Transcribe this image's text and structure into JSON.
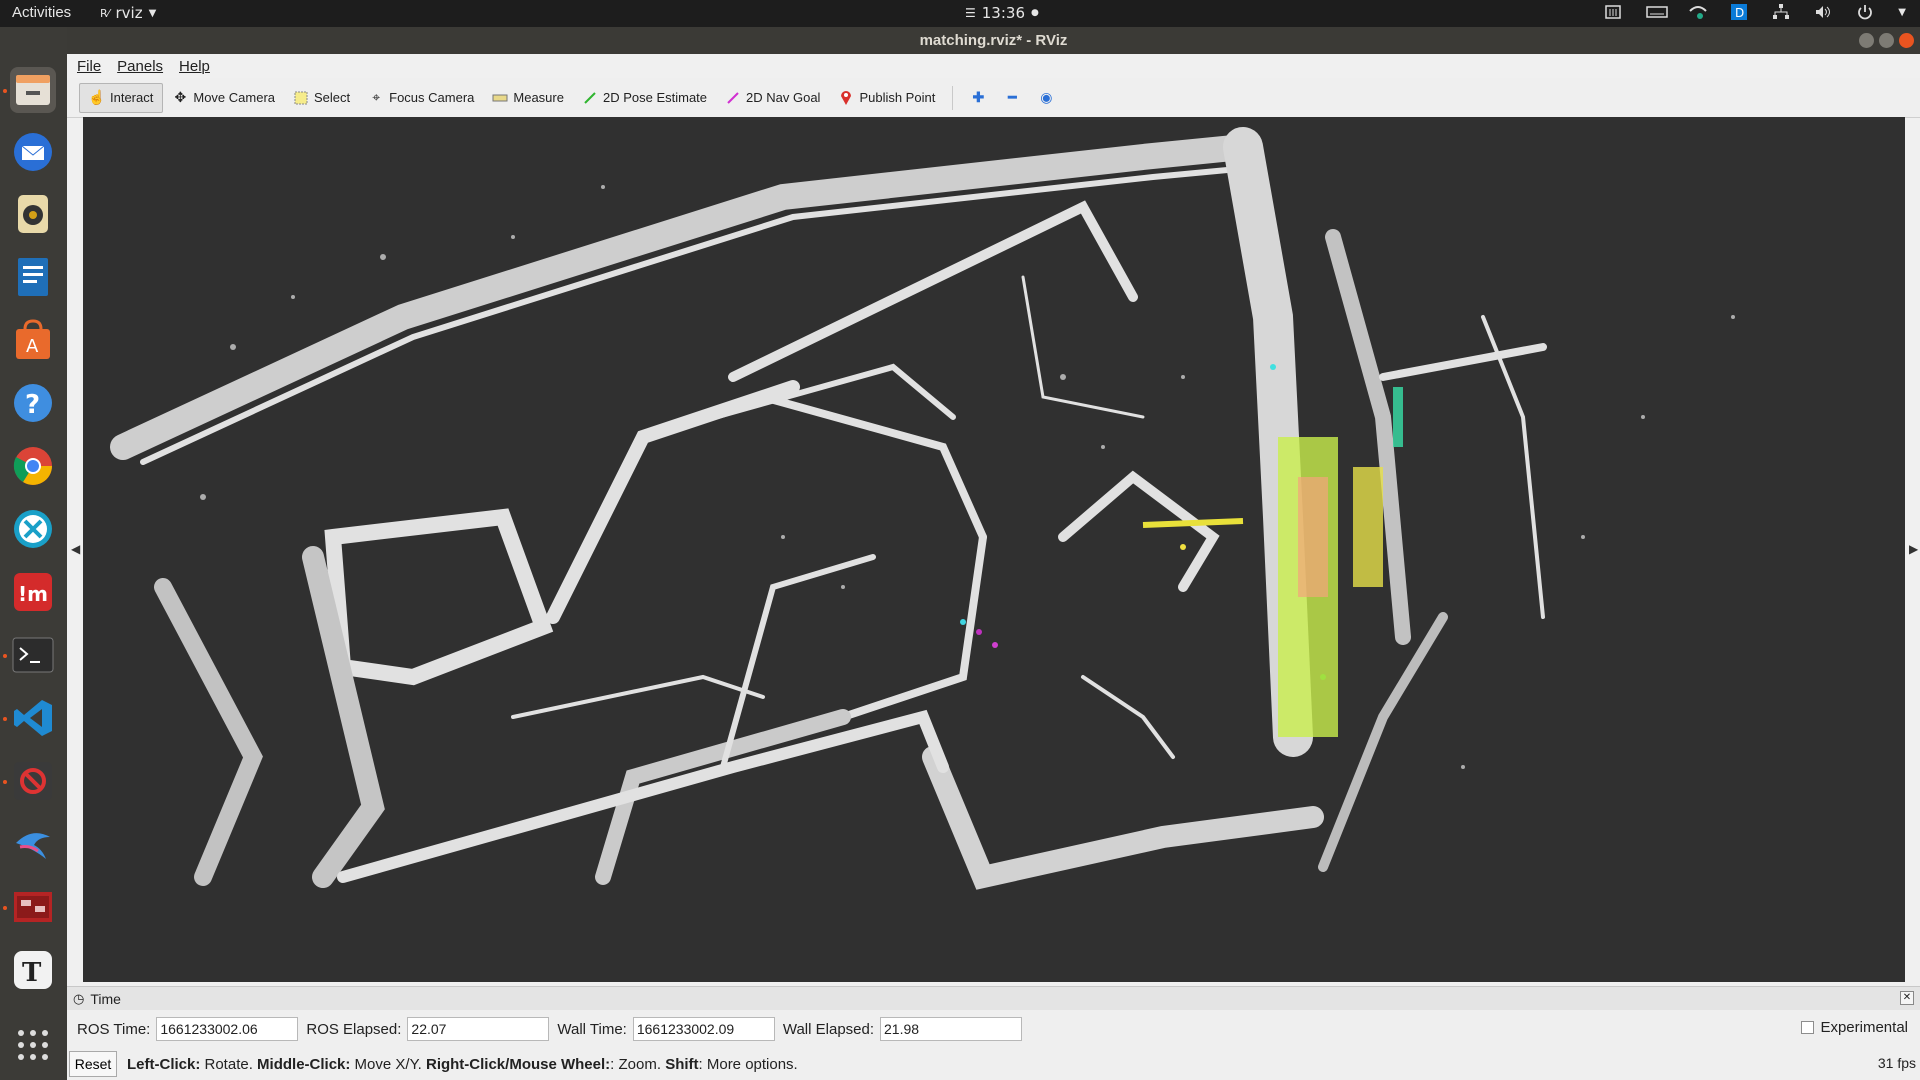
{
  "topbar": {
    "activities": "Activities",
    "app_name": "rviz",
    "clock": "13:36"
  },
  "window": {
    "title": "matching.rviz* - RViz"
  },
  "menu": {
    "file": "File",
    "panels": "Panels",
    "help": "Help"
  },
  "toolbar": {
    "interact": "Interact",
    "move_camera": "Move Camera",
    "select": "Select",
    "focus_camera": "Focus Camera",
    "measure": "Measure",
    "pose_estimate": "2D Pose Estimate",
    "nav_goal": "2D Nav Goal",
    "publish_point": "Publish Point"
  },
  "time_panel": {
    "title": "Time",
    "ros_time_label": "ROS Time:",
    "ros_time": "1661233002.06",
    "ros_elapsed_label": "ROS Elapsed:",
    "ros_elapsed": "22.07",
    "wall_time_label": "Wall Time:",
    "wall_time": "1661233002.09",
    "wall_elapsed_label": "Wall Elapsed:",
    "wall_elapsed": "21.98",
    "experimental": "Experimental"
  },
  "status": {
    "reset": "Reset",
    "left_click": "Left-Click:",
    "left_desc": " Rotate. ",
    "middle_click": "Middle-Click:",
    "middle_desc": " Move X/Y. ",
    "right_click": "Right-Click/Mouse Wheel:",
    "right_desc": ": Zoom. ",
    "shift": "Shift",
    "shift_desc": ": More options.",
    "fps": "31 fps"
  },
  "colors": {
    "accent": "#e95420",
    "viewport_bg": "#303030",
    "dock_bg": "#3c3b37"
  }
}
